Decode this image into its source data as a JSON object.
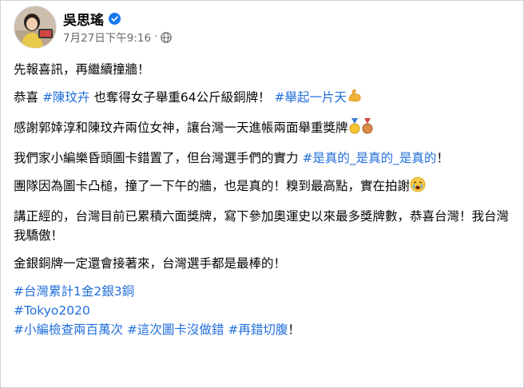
{
  "post": {
    "author": "吳思瑤",
    "timestamp": "7月27日下午9:16",
    "separator": "·",
    "icons": {
      "verified": "verified-badge-icon",
      "audience": "globe-icon"
    },
    "colors": {
      "hashtag": "#216fdb",
      "meta": "#65676b",
      "verified": "#1877f2"
    },
    "paragraphs": {
      "p1": "先報喜訊，再繼續撞牆！",
      "p2_a": "恭喜 ",
      "p2_tag1": "#陳玟卉",
      "p2_b": " 也奪得女子舉重64公斤級銅牌！ ",
      "p2_tag2": "#舉起一片天",
      "p3": "感謝郭婞淳和陳玟卉兩位女神，讓台灣一天進帳兩面舉重獎牌",
      "p4_a": "我們家小編樂昏頭圖卡錯置了，但台灣選手們的實力 ",
      "p4_tag": "#是真的_是真的_是真的",
      "p4_b": "！",
      "p5": "團隊因為圖卡凸槌，撞了一下午的牆，也是真的！糗到最高點，實在拍謝",
      "p6": "講正經的，台灣目前已累積六面獎牌，寫下參加奧運史以來最多獎牌數，恭喜台灣！我台灣我驕傲！",
      "p7": "金銀銅牌一定還會接著來，台灣選手都是最棒的！"
    },
    "hashtags_block": {
      "line1": "#台灣累計1金2銀3銅",
      "line2": "#Tokyo2020",
      "line3_tag1": "#小編檢查兩百萬次",
      "line3_tag2": "#這次圖卡沒做錯",
      "line3_tag3": "#再錯切腹",
      "line3_end": "！"
    },
    "emojis": [
      "flexed-biceps-emoji",
      "gold-medal-emoji",
      "bronze-medal-emoji",
      "weary-face-emoji"
    ]
  }
}
